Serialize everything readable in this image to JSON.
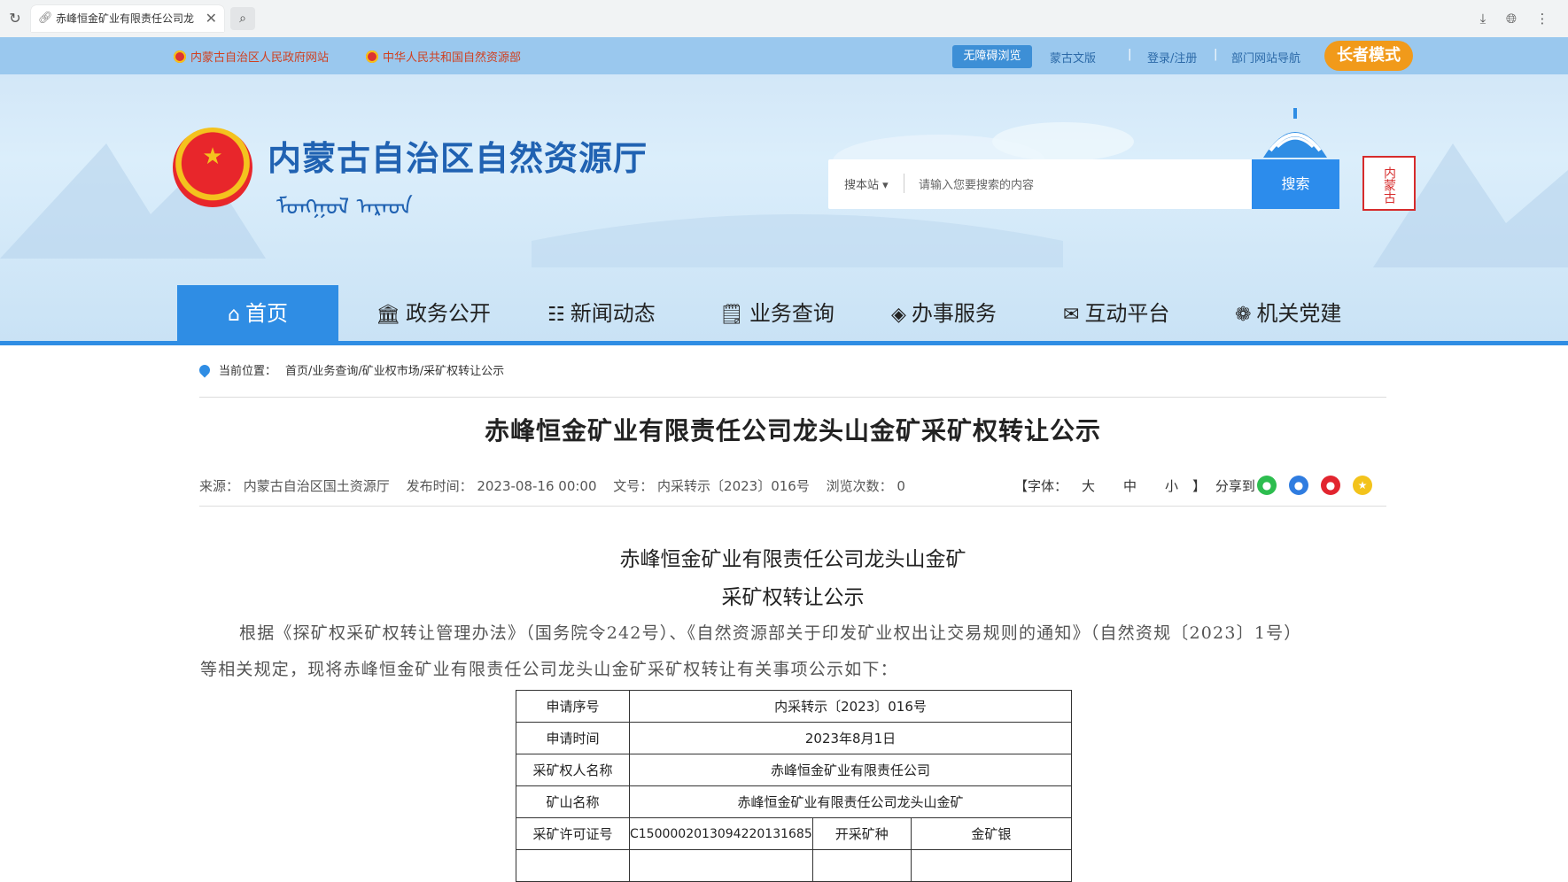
{
  "browser": {
    "tab_title": "赤峰恒金矿业有限责任公司龙",
    "reload_icon": "reload-icon",
    "icons": [
      "download-icon",
      "globe-icon",
      "more-icon"
    ]
  },
  "topbar": {
    "link_gov": "内蒙古自治区人民政府网站",
    "link_ministry": "中华人民共和国自然资源部",
    "accessible": "无障碍浏览",
    "mongolian": "蒙古文版",
    "login": "登录/注册",
    "dept_nav": "部门网站导航",
    "elder_mode": "长者模式"
  },
  "header": {
    "site_title": "内蒙古自治区自然资源厅",
    "site_title_mongolian": "ᠮᠣᠩᠭᠣᠯ ᠠᠷᠠᠳ",
    "seal_text": "内蒙古"
  },
  "search": {
    "scope": "搜本站",
    "placeholder": "请输入您要搜索的内容",
    "button": "搜索"
  },
  "nav": {
    "items": [
      "首页",
      "政务公开",
      "新闻动态",
      "业务查询",
      "办事服务",
      "互动平台",
      "机关党建"
    ],
    "active": "首页"
  },
  "breadcrumb": {
    "label": "当前位置：",
    "path": "首页/业务查询/矿业权市场/采矿权转让公示"
  },
  "article": {
    "title": "赤峰恒金矿业有限责任公司龙头山金矿采矿权转让公示",
    "source": "来源：  内蒙古自治区国土资源厅",
    "publish_time": "发布时间：  2023-08-16 00:00",
    "doc_no": "文号：  内采转示〔2023〕016号",
    "views": "浏览次数：  0",
    "font_label": "【字体：",
    "font_large": "大",
    "font_medium": "中",
    "font_small": "小",
    "font_close": "】",
    "share_label": "分享到",
    "share_icons": [
      "wechat-icon",
      "qq-icon",
      "weibo-icon",
      "qzone-icon"
    ]
  },
  "doc": {
    "heading1": "赤峰恒金矿业有限责任公司龙头山金矿",
    "heading2": "采矿权转让公示",
    "para_line1": "根据《探矿权采矿权转让管理办法》（国务院令242号）、《自然资源部关于印发矿业权出让交易规则的通知》（自然资规〔2023〕1号）",
    "para_line2": "等相关规定，现将赤峰恒金矿业有限责任公司龙头山金矿采矿权转让有关事项公示如下："
  },
  "table": {
    "rows": [
      [
        "申请序号",
        "内采转示〔2023〕016号"
      ],
      [
        "申请时间",
        "2023年8月1日"
      ],
      [
        "采矿权人名称",
        "赤峰恒金矿业有限责任公司"
      ],
      [
        "矿山名称",
        "赤峰恒金矿业有限责任公司龙头山金矿"
      ]
    ],
    "license_label": "采矿许可证号",
    "license_value": "C1500002013094220131685",
    "mineral_label": "开采矿种",
    "mineral_value": "金矿银"
  }
}
